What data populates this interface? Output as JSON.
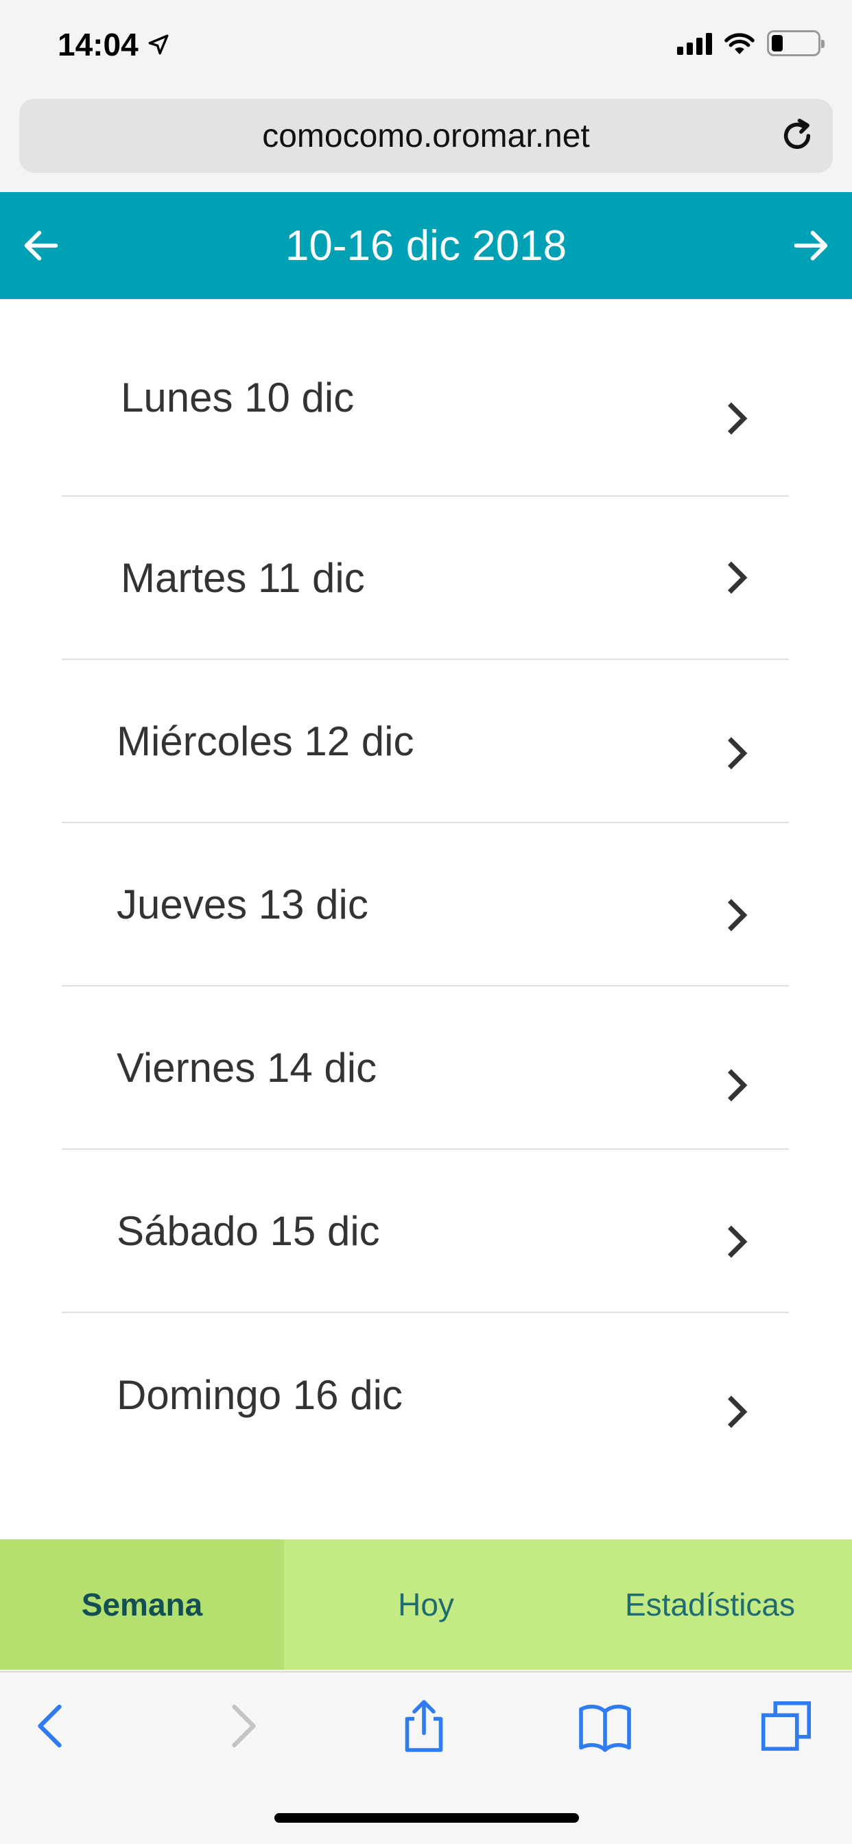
{
  "status_bar": {
    "time": "14:04",
    "icons": [
      "location-arrow-icon",
      "cellular-signal-icon",
      "wifi-icon",
      "battery-icon"
    ]
  },
  "browser": {
    "url": "comocomo.oromar.net"
  },
  "header": {
    "title": "10-16 dic 2018",
    "color": "#00a0b5"
  },
  "days": [
    {
      "label": "Lunes 10 dic"
    },
    {
      "label": "Martes 11 dic"
    },
    {
      "label": "Miércoles 12 dic"
    },
    {
      "label": "Jueves 13 dic"
    },
    {
      "label": "Viernes 14 dic"
    },
    {
      "label": "Sábado 15 dic"
    },
    {
      "label": "Domingo 16 dic"
    }
  ],
  "tabs": [
    {
      "label": "Semana",
      "active": true
    },
    {
      "label": "Hoy",
      "active": false
    },
    {
      "label": "Estadísticas",
      "active": false
    }
  ],
  "safari_toolbar": {
    "buttons": [
      "back-icon",
      "forward-icon",
      "share-icon",
      "bookmarks-icon",
      "tabs-icon"
    ]
  }
}
